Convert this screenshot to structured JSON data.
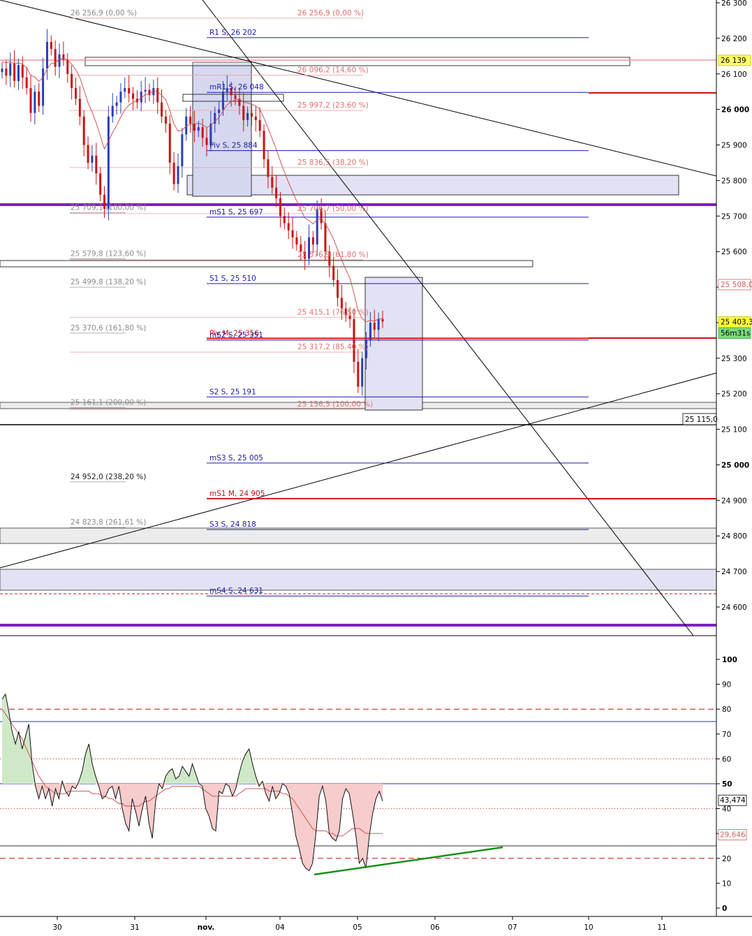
{
  "chart_data": [
    {
      "type": "candlestick",
      "title": "",
      "ylim": [
        24540,
        26300
      ],
      "x_ticks": [
        "30",
        "31",
        "nov.",
        "04",
        "05",
        "06",
        "07",
        "10",
        "11"
      ],
      "y_ticks": [
        "26 300",
        "26 200",
        "26 100",
        "26 000",
        "25 900",
        "25 800",
        "25 700",
        "25 600",
        "25 500",
        "25 400",
        "25 300",
        "25 200",
        "25 100",
        "25 000",
        "24 900",
        "24 800",
        "24 700",
        "24 600"
      ],
      "y_ticks_values": [
        26300,
        26200,
        26100,
        26000,
        25900,
        25800,
        25700,
        25600,
        25500,
        25400,
        25300,
        25200,
        25100,
        25000,
        24900,
        24800,
        24700,
        24600
      ],
      "price_badges": [
        {
          "text": "26 139",
          "value": 26139,
          "bg": "#ffff66",
          "fg": "#000000",
          "border": "#bfbf00"
        },
        {
          "text": "25 508,0",
          "value": 25508,
          "bg": "#ffffff",
          "fg": "#d06060",
          "border": "#d06060"
        },
        {
          "text": "25 403,3",
          "value": 25403,
          "bg": "#ffff33",
          "fg": "#000000",
          "border": "#bfbf00"
        },
        {
          "text": "56m31s",
          "value": 25371,
          "bg": "#7ddc7d",
          "fg": "#000000",
          "border": "#40a040"
        },
        {
          "text": "25 115,0",
          "value": 25115,
          "bg": "#ffffff",
          "fg": "#000000",
          "border": "#000000",
          "inside": true
        }
      ],
      "pivot_labels": [
        {
          "text": "R1 S, 26 202",
          "value": 26202,
          "color": "#1a1aa8"
        },
        {
          "text": "mR1 S, 26 048",
          "value": 26048,
          "color": "#1a1aa8"
        },
        {
          "text": "Piv S, 25 884",
          "value": 25884,
          "color": "#1a1aa8"
        },
        {
          "text": "mS1 S, 25 697",
          "value": 25697,
          "color": "#1a1aa8"
        },
        {
          "text": "S1 S, 25 510",
          "value": 25510,
          "color": "#1a1aa8"
        },
        {
          "text": "Piv M, 25 356",
          "value": 25356,
          "color": "#cc1111"
        },
        {
          "text": "mS2 S, 25 351",
          "value": 25351,
          "color": "#1a1aa8"
        },
        {
          "text": "S2 S, 25 191",
          "value": 25191,
          "color": "#1a1aa8"
        },
        {
          "text": "mS3 S, 25 005",
          "value": 25005,
          "color": "#1a1aa8"
        },
        {
          "text": "mS1 M, 24 905",
          "value": 24905,
          "color": "#cc1111"
        },
        {
          "text": "S3 S, 24 818",
          "value": 24818,
          "color": "#1a1aa8"
        },
        {
          "text": "mS4 S, 24 631",
          "value": 24631,
          "color": "#1a1aa8"
        }
      ],
      "fib_left_labels": [
        {
          "text": "26 256,9 (0,00 %)",
          "value": 26256.9
        },
        {
          "text": "25 709,1 (100,00 %)",
          "value": 25709.1
        },
        {
          "text": "25 579,8 (123,60 %)",
          "value": 25579.8
        },
        {
          "text": "25 499,8 (138,20 %)",
          "value": 25499.8
        },
        {
          "text": "25 370,6 (161,80 %)",
          "value": 25370.6
        },
        {
          "text": "25 161,1 (200,00 %)",
          "value": 25161.1
        },
        {
          "text": "24 952,0 (238,20 %)",
          "value": 24952.0,
          "dark": true
        },
        {
          "text": "24 823,8 (261,61 %)",
          "value": 24823.8
        }
      ],
      "fib_right_labels": [
        {
          "text": "26 256,9 (0,00 %)",
          "value": 26256.9
        },
        {
          "text": "26 096,2 (14,60 %)",
          "value": 26096.2
        },
        {
          "text": "25 997,2 (23,60 %)",
          "value": 25997.2
        },
        {
          "text": "25 836,5 (38,20 %)",
          "value": 25836.5
        },
        {
          "text": "25 706,7 (50,00 %)",
          "value": 25706.7
        },
        {
          "text": "25 576,9 (61,80 %)",
          "value": 25576.9
        },
        {
          "text": "25 415,1 (76,50 %)",
          "value": 25415.1
        },
        {
          "text": "25 317,2 (85,40 %)",
          "value": 25317.2
        },
        {
          "text": "25 156,5 (100,00 %)",
          "value": 25156.5
        }
      ],
      "series_close": [
        26115,
        26095,
        26130,
        26080,
        26125,
        26090,
        26060,
        25990,
        26050,
        26010,
        26115,
        26190,
        26170,
        26120,
        26155,
        26140,
        26100,
        26060,
        26030,
        25980,
        25900,
        25850,
        25870,
        25820,
        25760,
        25720,
        25980,
        26010,
        26020,
        26050,
        26060,
        26045,
        26030,
        26020,
        26050,
        26055,
        26040,
        26060,
        26020,
        25980,
        25960,
        25850,
        25790,
        25840,
        25930,
        25980,
        25960,
        25940,
        25950,
        25920,
        25900,
        25960,
        25990,
        26000,
        26050,
        26060,
        26040,
        26030,
        26010,
        25970,
        25990,
        25980,
        25970,
        25940,
        25860,
        25810,
        25780,
        25750,
        25700,
        25680,
        25660,
        25640,
        25620,
        25600,
        25580,
        25640,
        25620,
        25720,
        25680,
        25600,
        25560,
        25520,
        25470,
        25440,
        25420,
        25410,
        25290,
        25220,
        25300,
        25350,
        25400,
        25380,
        25410,
        25403
      ]
    },
    {
      "type": "line",
      "title": "",
      "ylim": [
        -5,
        105
      ],
      "y_ticks": [
        "100",
        "90",
        "80",
        "70",
        "60",
        "50",
        "40",
        "30",
        "20",
        "10",
        "0"
      ],
      "y_ticks_values": [
        100,
        90,
        80,
        70,
        60,
        50,
        40,
        30,
        20,
        10,
        0
      ],
      "levels": {
        "solid": [
          75,
          50,
          25
        ],
        "dashed": [
          80,
          20
        ],
        "dotted": [
          60,
          40
        ]
      },
      "badges": [
        {
          "text": "43,474",
          "value": 43.474,
          "bg": "#ffffff",
          "fg": "#000000",
          "border": "#000000"
        },
        {
          "text": "29,646",
          "value": 29.646,
          "bg": "#ffffff",
          "fg": "#d06060",
          "border": "#d06060"
        }
      ],
      "series": [
        {
          "values": [
            84,
            86,
            79,
            71,
            66,
            71,
            64,
            69,
            74,
            58,
            49,
            44,
            49,
            44,
            48,
            41,
            48,
            44,
            51,
            47,
            45,
            49,
            48,
            51,
            55,
            62,
            66,
            58,
            53,
            49,
            44,
            45,
            48,
            49,
            44,
            49,
            40,
            34,
            31,
            44,
            39,
            33,
            40,
            45,
            34,
            28,
            43,
            50,
            48,
            53,
            55,
            56,
            52,
            53,
            57,
            55,
            53,
            58,
            54,
            50,
            49,
            40,
            37,
            32,
            31,
            47,
            46,
            50,
            49,
            45,
            48,
            54,
            59,
            62,
            64,
            58,
            53,
            49,
            51,
            46,
            43,
            49,
            44,
            46,
            50,
            49,
            46,
            38,
            29,
            24,
            18,
            16,
            15,
            18,
            30,
            45,
            49,
            43,
            30,
            28,
            27,
            31,
            44,
            48,
            46,
            38,
            29,
            18,
            20,
            16,
            29,
            38,
            44,
            47,
            43
          ]
        },
        {
          "values": [
            80,
            78,
            76,
            74,
            72,
            70,
            68,
            65,
            62,
            59,
            56,
            53,
            51,
            49,
            48,
            47,
            46,
            46,
            46,
            46,
            47,
            47,
            47,
            47,
            47,
            47,
            47,
            46,
            46,
            46,
            45,
            45,
            44,
            44,
            43,
            42,
            42,
            41,
            41,
            41,
            41,
            41,
            42,
            43,
            43,
            44,
            45,
            46,
            47,
            48,
            48,
            49,
            49,
            49,
            49,
            49,
            49,
            49,
            49,
            49,
            48,
            47,
            46,
            45,
            45,
            45,
            45,
            45,
            45,
            45,
            45,
            46,
            47,
            48,
            48,
            48,
            48,
            48,
            48,
            48,
            47,
            47,
            47,
            47,
            46,
            46,
            45,
            44,
            42,
            40,
            38,
            36,
            34,
            32,
            31,
            31,
            31,
            31,
            30,
            30,
            29,
            29,
            29,
            30,
            31,
            32,
            32,
            32,
            31,
            30,
            30,
            30,
            30,
            30,
            30
          ]
        }
      ]
    }
  ]
}
